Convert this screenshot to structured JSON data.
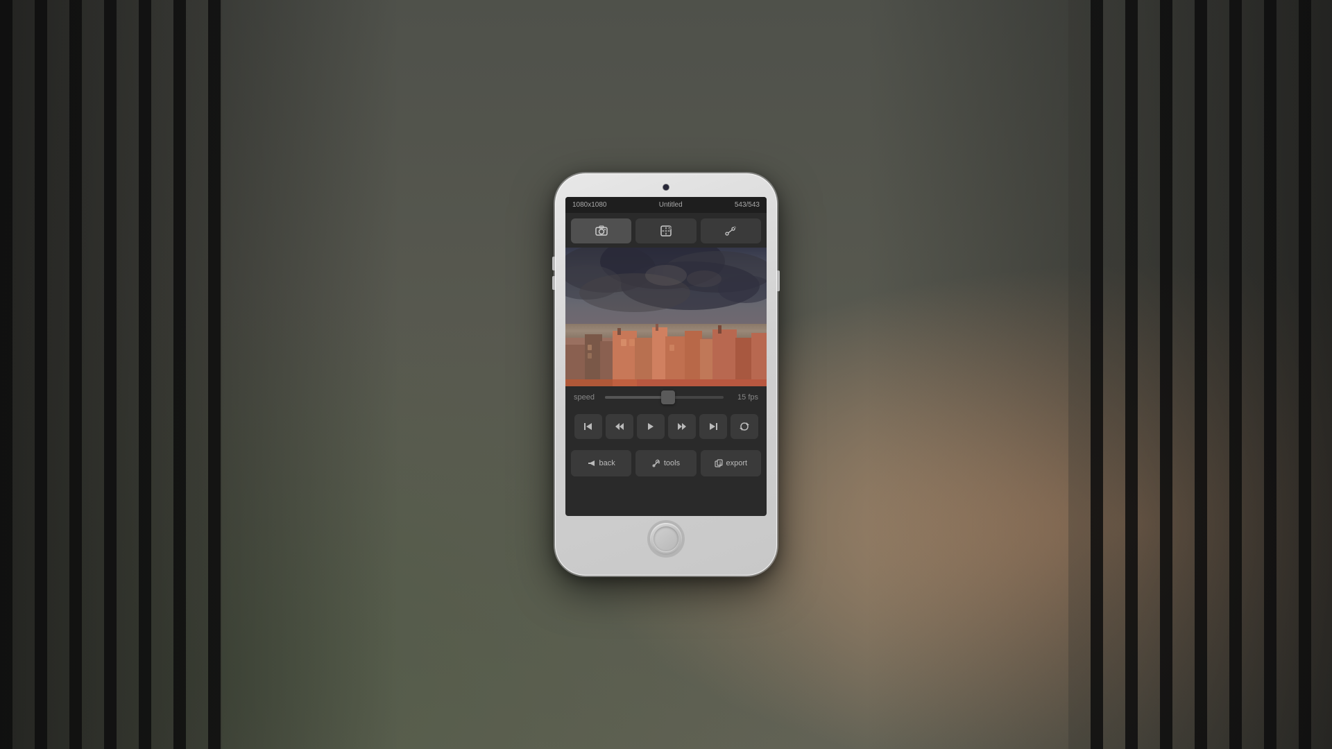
{
  "background": {
    "color": "#7a8068"
  },
  "phone": {
    "screen": {
      "topbar": {
        "resolution": "1080x1080",
        "title": "Untitled",
        "counter": "543/543"
      },
      "tabs": [
        {
          "id": "camera",
          "icon": "📷",
          "active": true
        },
        {
          "id": "frames",
          "icon": "⬜",
          "active": false
        },
        {
          "id": "path",
          "icon": "↗",
          "active": false
        }
      ],
      "speed": {
        "label": "speed",
        "value": "15 fps",
        "percent": 55
      },
      "transport": [
        {
          "id": "skip-back",
          "icon": "⏮"
        },
        {
          "id": "rewind",
          "icon": "⏪"
        },
        {
          "id": "play",
          "icon": "▶"
        },
        {
          "id": "fast-forward",
          "icon": "⏩"
        },
        {
          "id": "skip-forward",
          "icon": "⏭"
        },
        {
          "id": "loop",
          "icon": "🔁"
        }
      ],
      "actions": [
        {
          "id": "back",
          "icon": "←",
          "label": "back"
        },
        {
          "id": "tools",
          "icon": "🔧",
          "label": "tools"
        },
        {
          "id": "export",
          "icon": "📤",
          "label": "export"
        }
      ]
    }
  }
}
